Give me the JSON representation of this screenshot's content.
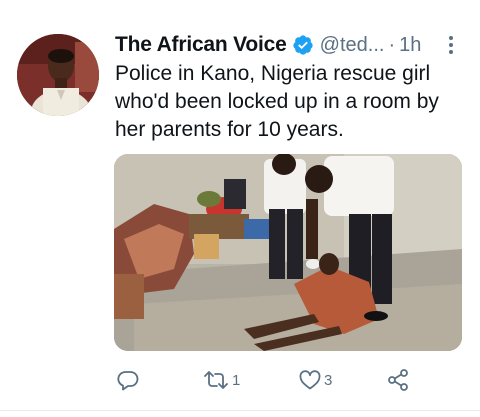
{
  "tweet": {
    "display_name": "The African Voice",
    "handle": "@ted...",
    "separator": "·",
    "time": "1h",
    "verified_icon": "verified-badge-icon",
    "more_icon": "more-options-icon",
    "text_lines": [
      "Police in Kano, Nigeria rescue girl",
      "who'd been locked up in a room by",
      "her parents for 10 years."
    ],
    "actions": {
      "reply": {
        "icon": "reply-icon",
        "count": ""
      },
      "retweet": {
        "icon": "retweet-icon",
        "count": "1"
      },
      "like": {
        "icon": "heart-icon",
        "count": "3"
      },
      "share": {
        "icon": "share-icon",
        "count": ""
      }
    },
    "colors": {
      "text": "#0f1419",
      "secondary": "#5b7083",
      "verified": "#1da1f2",
      "divider": "#e6ecf0"
    }
  }
}
